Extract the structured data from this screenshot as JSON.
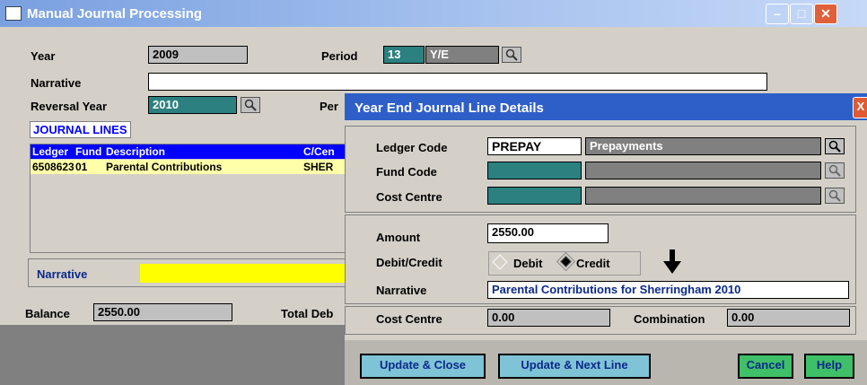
{
  "main": {
    "title": "Manual Journal Processing",
    "year_label": "Year",
    "year_value": "2009",
    "period_label": "Period",
    "period_number": "13",
    "period_value": "Y/E",
    "narrative_label": "Narrative",
    "narrative_value": "",
    "reversal_year_label": "Reversal Year",
    "reversal_year_value": "2010",
    "reversal_period_label_partial": "Per",
    "journal_lines_label": "JOURNAL LINES",
    "grid": {
      "headers": [
        "Ledger",
        "Fund",
        "Description",
        "C/Cen"
      ],
      "rows": [
        [
          "6508623",
          "01",
          "Parental Contributions",
          "SHER"
        ]
      ]
    },
    "line_narrative_label": "Narrative",
    "balance_label": "Balance",
    "balance_value": "2550.00",
    "total_debit_label_partial": "Total Deb"
  },
  "dialog": {
    "title": "Year End Journal Line Details",
    "ledger_code_label": "Ledger Code",
    "ledger_code_value": "PREPAY",
    "ledger_code_desc": "Prepayments",
    "fund_code_label": "Fund Code",
    "fund_code_value": "",
    "cost_centre_label": "Cost Centre",
    "cost_centre_value": "",
    "amount_label": "Amount",
    "amount_value": "2550.00",
    "debit_credit_label": "Debit/Credit",
    "debit_option": "Debit",
    "credit_option": "Credit",
    "selected_option": "Credit",
    "narrative_label": "Narrative",
    "narrative_value": "Parental Contributions for Sherringham 2010",
    "cost_centre_total_label": "Cost Centre",
    "cost_centre_total_value": "0.00",
    "combination_label": "Combination",
    "combination_value": "0.00",
    "buttons": {
      "update_close": "Update & Close",
      "update_next": "Update & Next Line",
      "cancel": "Cancel",
      "help": "Help"
    }
  },
  "colors": {
    "title_bar": "#2e5fc9",
    "teal_field": "#2c8080",
    "grid_header": "#0000ff",
    "grid_row": "#ffffaa",
    "highlight": "#ffff00"
  }
}
